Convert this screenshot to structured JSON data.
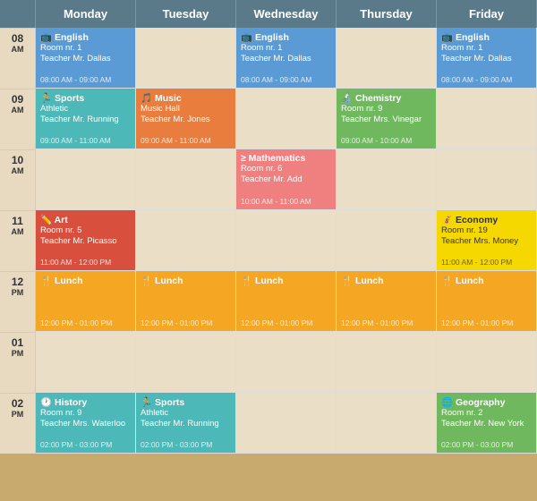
{
  "header": {
    "days": [
      "",
      "Monday",
      "Tuesday",
      "Wednesday",
      "Thursday",
      "Friday"
    ]
  },
  "rows": [
    {
      "time": {
        "hour": "08",
        "ampm": "AM"
      },
      "slots": [
        {
          "type": "event",
          "color": "blue",
          "icon": "📺",
          "title": "English",
          "room": "Room nr. 1",
          "teacher": "Teacher Mr. Dallas",
          "time_range": "08:00 AM - 09:00 AM"
        },
        {
          "type": "empty"
        },
        {
          "type": "event",
          "color": "blue",
          "icon": "📺",
          "title": "English",
          "room": "Room nr. 1",
          "teacher": "Teacher Mr. Dallas",
          "time_range": "08:00 AM - 09:00 AM"
        },
        {
          "type": "empty"
        },
        {
          "type": "event",
          "color": "blue",
          "icon": "📺",
          "title": "English",
          "room": "Room nr. 1",
          "teacher": "Teacher Mr. Dallas",
          "time_range": "08:00 AM - 09:00 AM"
        }
      ]
    },
    {
      "time": {
        "hour": "09",
        "ampm": "AM"
      },
      "slots": [
        {
          "type": "event",
          "color": "teal",
          "icon": "🏃",
          "title": "Sports",
          "room": "Athletic",
          "teacher": "Teacher Mr. Running",
          "time_range": "09:00 AM - 11:00 AM"
        },
        {
          "type": "event",
          "color": "orange",
          "icon": "🎵",
          "title": "Music",
          "room": "Music Hall",
          "teacher": "Teacher Mr. Jones",
          "time_range": "09:00 AM - 11:00 AM"
        },
        {
          "type": "empty"
        },
        {
          "type": "event",
          "color": "green",
          "icon": "🔬",
          "title": "Chemistry",
          "room": "Room nr. 9",
          "teacher": "Teacher Mrs. Vinegar",
          "time_range": "09:00 AM - 10:00 AM"
        },
        {
          "type": "empty"
        }
      ]
    },
    {
      "time": {
        "hour": "10",
        "ampm": "AM"
      },
      "slots": [
        {
          "type": "empty"
        },
        {
          "type": "empty"
        },
        {
          "type": "event",
          "color": "salmon",
          "icon": "≥",
          "title": "Mathematics",
          "room": "Room nr. 6",
          "teacher": "Teacher Mr. Add",
          "time_range": "10:00 AM - 11:00 AM"
        },
        {
          "type": "empty"
        },
        {
          "type": "empty"
        }
      ]
    },
    {
      "time": {
        "hour": "11",
        "ampm": "AM"
      },
      "slots": [
        {
          "type": "event",
          "color": "red",
          "icon": "✏️",
          "title": "Art",
          "room": "Room nr. 5",
          "teacher": "Teacher Mr. Picasso",
          "time_range": "11:00 AM - 12:00 PM"
        },
        {
          "type": "empty"
        },
        {
          "type": "empty"
        },
        {
          "type": "empty"
        },
        {
          "type": "event",
          "color": "yellow",
          "icon": "💰",
          "title": "Economy",
          "room": "Room nr. 19",
          "teacher": "Teacher Mrs. Money",
          "time_range": "11:00 AM - 12:00 PM"
        }
      ]
    },
    {
      "time": {
        "hour": "12",
        "ampm": "PM"
      },
      "slots": [
        {
          "type": "event",
          "color": "lunch-color",
          "icon": "🍴",
          "title": "Lunch",
          "room": "",
          "teacher": "",
          "time_range": "12:00 PM - 01:00 PM"
        },
        {
          "type": "event",
          "color": "lunch-color",
          "icon": "🍴",
          "title": "Lunch",
          "room": "",
          "teacher": "",
          "time_range": "12:00 PM - 01:00 PM"
        },
        {
          "type": "event",
          "color": "lunch-color",
          "icon": "🍴",
          "title": "Lunch",
          "room": "",
          "teacher": "",
          "time_range": "12:00 PM - 01:00 PM"
        },
        {
          "type": "event",
          "color": "lunch-color",
          "icon": "🍴",
          "title": "Lunch",
          "room": "",
          "teacher": "",
          "time_range": "12:00 PM - 01:00 PM"
        },
        {
          "type": "event",
          "color": "lunch-color",
          "icon": "🍴",
          "title": "Lunch",
          "room": "",
          "teacher": "",
          "time_range": "12:00 PM - 01:00 PM"
        }
      ]
    },
    {
      "time": {
        "hour": "01",
        "ampm": "PM"
      },
      "slots": [
        {
          "type": "empty"
        },
        {
          "type": "empty"
        },
        {
          "type": "empty"
        },
        {
          "type": "empty"
        },
        {
          "type": "empty"
        }
      ]
    },
    {
      "time": {
        "hour": "02",
        "ampm": "PM"
      },
      "slots": [
        {
          "type": "event",
          "color": "teal",
          "icon": "🕐",
          "title": "History",
          "room": "Room nr. 9",
          "teacher": "Teacher Mrs. Waterloo",
          "time_range": "02:00 PM - 03:00 PM"
        },
        {
          "type": "event",
          "color": "teal",
          "icon": "🏃",
          "title": "Sports",
          "room": "Athletic",
          "teacher": "Teacher Mr. Running",
          "time_range": "02:00 PM - 03:00 PM"
        },
        {
          "type": "empty"
        },
        {
          "type": "empty"
        },
        {
          "type": "event",
          "color": "green",
          "icon": "🌐",
          "title": "Geography",
          "room": "Room nr. 2",
          "teacher": "Teacher Mr. New York",
          "time_range": "02:00 PM - 03:00 PM"
        }
      ]
    }
  ]
}
